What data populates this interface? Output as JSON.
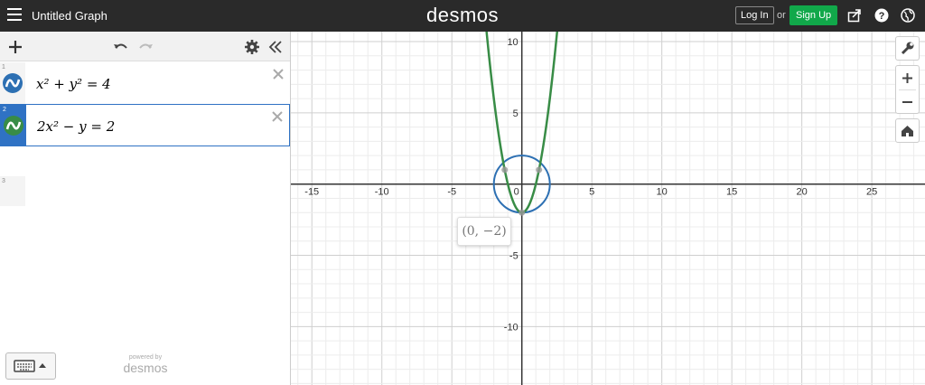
{
  "topbar": {
    "title": "Untitled Graph",
    "logo": "desmos",
    "login_label": "Log In",
    "or_label": "or",
    "signup_label": "Sign Up"
  },
  "expressions": [
    {
      "index": "1",
      "latex_text": "x² + y² = 4",
      "color": "#2d70b3"
    },
    {
      "index": "2",
      "latex_text": "2x² − y = 2",
      "color": "#388c46"
    }
  ],
  "empty_row_index": "3",
  "powered_by": {
    "small": "powered by",
    "brand": "desmos"
  },
  "graph": {
    "x_range": [
      -16.5,
      28.8
    ],
    "y_range": [
      -14.1,
      10.7
    ],
    "x_ticks": [
      -15,
      -10,
      -5,
      0,
      5,
      10,
      15,
      20,
      25
    ],
    "y_ticks": [
      -10,
      -5,
      5,
      10
    ],
    "grid": true
  },
  "point_label": "(0, −2)",
  "colors": {
    "accent": "#2f72c4",
    "topbar": "#2a2a2a",
    "signup": "#11a84a",
    "circle": "#2d70b3",
    "parabola": "#388c46"
  }
}
